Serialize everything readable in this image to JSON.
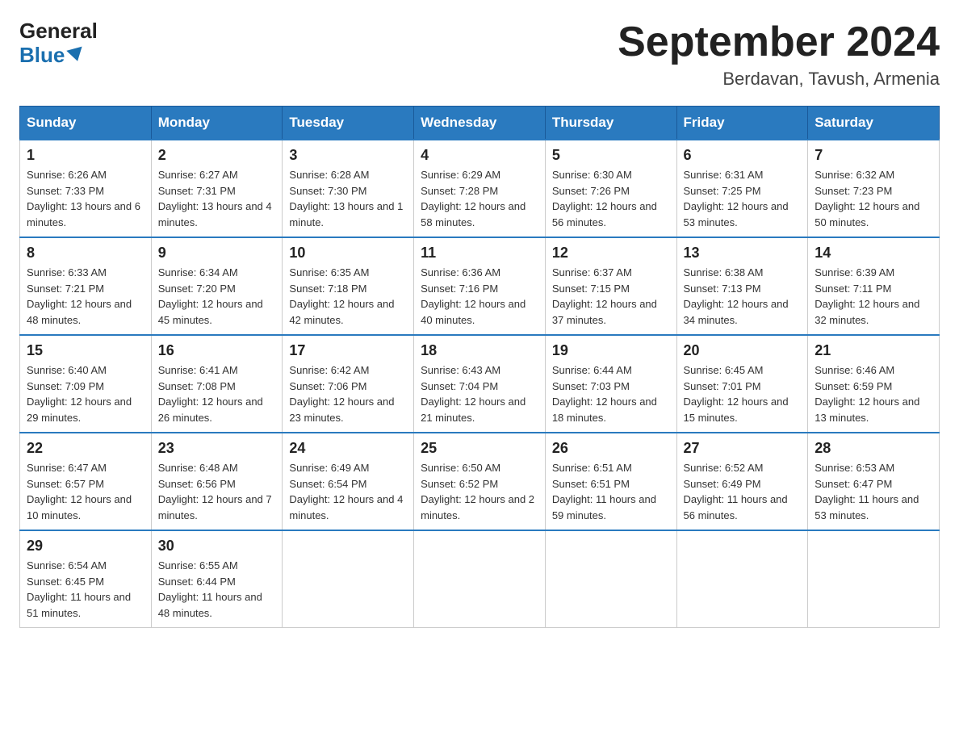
{
  "header": {
    "logo_general": "General",
    "logo_blue": "Blue",
    "month_title": "September 2024",
    "location": "Berdavan, Tavush, Armenia"
  },
  "days_of_week": [
    "Sunday",
    "Monday",
    "Tuesday",
    "Wednesday",
    "Thursday",
    "Friday",
    "Saturday"
  ],
  "weeks": [
    [
      {
        "day": "1",
        "sunrise": "6:26 AM",
        "sunset": "7:33 PM",
        "daylight": "13 hours and 6 minutes."
      },
      {
        "day": "2",
        "sunrise": "6:27 AM",
        "sunset": "7:31 PM",
        "daylight": "13 hours and 4 minutes."
      },
      {
        "day": "3",
        "sunrise": "6:28 AM",
        "sunset": "7:30 PM",
        "daylight": "13 hours and 1 minute."
      },
      {
        "day": "4",
        "sunrise": "6:29 AM",
        "sunset": "7:28 PM",
        "daylight": "12 hours and 58 minutes."
      },
      {
        "day": "5",
        "sunrise": "6:30 AM",
        "sunset": "7:26 PM",
        "daylight": "12 hours and 56 minutes."
      },
      {
        "day": "6",
        "sunrise": "6:31 AM",
        "sunset": "7:25 PM",
        "daylight": "12 hours and 53 minutes."
      },
      {
        "day": "7",
        "sunrise": "6:32 AM",
        "sunset": "7:23 PM",
        "daylight": "12 hours and 50 minutes."
      }
    ],
    [
      {
        "day": "8",
        "sunrise": "6:33 AM",
        "sunset": "7:21 PM",
        "daylight": "12 hours and 48 minutes."
      },
      {
        "day": "9",
        "sunrise": "6:34 AM",
        "sunset": "7:20 PM",
        "daylight": "12 hours and 45 minutes."
      },
      {
        "day": "10",
        "sunrise": "6:35 AM",
        "sunset": "7:18 PM",
        "daylight": "12 hours and 42 minutes."
      },
      {
        "day": "11",
        "sunrise": "6:36 AM",
        "sunset": "7:16 PM",
        "daylight": "12 hours and 40 minutes."
      },
      {
        "day": "12",
        "sunrise": "6:37 AM",
        "sunset": "7:15 PM",
        "daylight": "12 hours and 37 minutes."
      },
      {
        "day": "13",
        "sunrise": "6:38 AM",
        "sunset": "7:13 PM",
        "daylight": "12 hours and 34 minutes."
      },
      {
        "day": "14",
        "sunrise": "6:39 AM",
        "sunset": "7:11 PM",
        "daylight": "12 hours and 32 minutes."
      }
    ],
    [
      {
        "day": "15",
        "sunrise": "6:40 AM",
        "sunset": "7:09 PM",
        "daylight": "12 hours and 29 minutes."
      },
      {
        "day": "16",
        "sunrise": "6:41 AM",
        "sunset": "7:08 PM",
        "daylight": "12 hours and 26 minutes."
      },
      {
        "day": "17",
        "sunrise": "6:42 AM",
        "sunset": "7:06 PM",
        "daylight": "12 hours and 23 minutes."
      },
      {
        "day": "18",
        "sunrise": "6:43 AM",
        "sunset": "7:04 PM",
        "daylight": "12 hours and 21 minutes."
      },
      {
        "day": "19",
        "sunrise": "6:44 AM",
        "sunset": "7:03 PM",
        "daylight": "12 hours and 18 minutes."
      },
      {
        "day": "20",
        "sunrise": "6:45 AM",
        "sunset": "7:01 PM",
        "daylight": "12 hours and 15 minutes."
      },
      {
        "day": "21",
        "sunrise": "6:46 AM",
        "sunset": "6:59 PM",
        "daylight": "12 hours and 13 minutes."
      }
    ],
    [
      {
        "day": "22",
        "sunrise": "6:47 AM",
        "sunset": "6:57 PM",
        "daylight": "12 hours and 10 minutes."
      },
      {
        "day": "23",
        "sunrise": "6:48 AM",
        "sunset": "6:56 PM",
        "daylight": "12 hours and 7 minutes."
      },
      {
        "day": "24",
        "sunrise": "6:49 AM",
        "sunset": "6:54 PM",
        "daylight": "12 hours and 4 minutes."
      },
      {
        "day": "25",
        "sunrise": "6:50 AM",
        "sunset": "6:52 PM",
        "daylight": "12 hours and 2 minutes."
      },
      {
        "day": "26",
        "sunrise": "6:51 AM",
        "sunset": "6:51 PM",
        "daylight": "11 hours and 59 minutes."
      },
      {
        "day": "27",
        "sunrise": "6:52 AM",
        "sunset": "6:49 PM",
        "daylight": "11 hours and 56 minutes."
      },
      {
        "day": "28",
        "sunrise": "6:53 AM",
        "sunset": "6:47 PM",
        "daylight": "11 hours and 53 minutes."
      }
    ],
    [
      {
        "day": "29",
        "sunrise": "6:54 AM",
        "sunset": "6:45 PM",
        "daylight": "11 hours and 51 minutes."
      },
      {
        "day": "30",
        "sunrise": "6:55 AM",
        "sunset": "6:44 PM",
        "daylight": "11 hours and 48 minutes."
      },
      null,
      null,
      null,
      null,
      null
    ]
  ]
}
